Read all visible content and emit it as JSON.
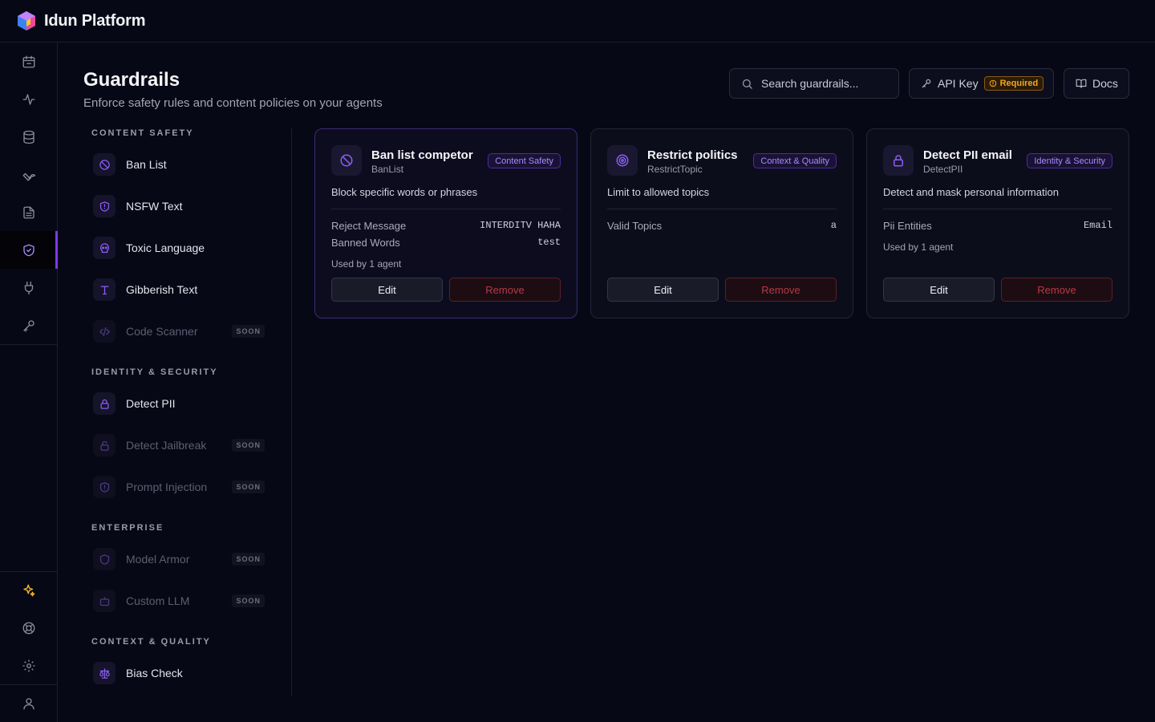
{
  "app": {
    "title": "Idun Platform"
  },
  "rail": {
    "items": [
      {
        "icon": "calendar-box-icon"
      },
      {
        "icon": "activity-icon"
      },
      {
        "icon": "database-icon"
      },
      {
        "icon": "wrench-icon"
      },
      {
        "icon": "document-icon"
      },
      {
        "icon": "shield-icon",
        "active": true
      },
      {
        "icon": "plug-icon"
      },
      {
        "icon": "key-icon"
      },
      {
        "icon": "sparkles-icon"
      },
      {
        "icon": "help-lifebuoy-icon"
      },
      {
        "icon": "settings-gear-icon"
      },
      {
        "icon": "user-icon"
      }
    ]
  },
  "header": {
    "title": "Guardrails",
    "subtitle": "Enforce safety rules and content policies on your agents",
    "search_placeholder": "Search guardrails...",
    "api_key_label": "API Key",
    "api_key_badge": "Required",
    "docs_label": "Docs"
  },
  "catalog": {
    "sections": [
      {
        "heading": "CONTENT SAFETY",
        "items": [
          {
            "label": "Ban List",
            "icon": "ban-icon",
            "soon": false
          },
          {
            "label": "NSFW Text",
            "icon": "shield-alert-icon",
            "soon": false
          },
          {
            "label": "Toxic Language",
            "icon": "skull-icon",
            "soon": false
          },
          {
            "label": "Gibberish Text",
            "icon": "type-icon",
            "soon": false
          },
          {
            "label": "Code Scanner",
            "icon": "code-icon",
            "soon": true,
            "soon_label": "SOON"
          }
        ]
      },
      {
        "heading": "IDENTITY & SECURITY",
        "items": [
          {
            "label": "Detect PII",
            "icon": "lock-icon",
            "soon": false
          },
          {
            "label": "Detect Jailbreak",
            "icon": "lock-open-icon",
            "soon": true,
            "soon_label": "SOON"
          },
          {
            "label": "Prompt Injection",
            "icon": "shield-alert-icon",
            "soon": true,
            "soon_label": "SOON"
          }
        ]
      },
      {
        "heading": "ENTERPRISE",
        "items": [
          {
            "label": "Model Armor",
            "icon": "shield-icon",
            "soon": true,
            "soon_label": "SOON"
          },
          {
            "label": "Custom LLM",
            "icon": "bot-icon",
            "soon": true,
            "soon_label": "SOON"
          }
        ]
      },
      {
        "heading": "CONTEXT & QUALITY",
        "items": [
          {
            "label": "Bias Check",
            "icon": "scale-icon",
            "soon": false
          }
        ]
      }
    ]
  },
  "cards": [
    {
      "title": "Ban list competor",
      "type": "BanList",
      "tag": "Content Safety",
      "description": "Block specific words or phrases",
      "params": [
        {
          "key": "Reject Message",
          "value": "INTERDITV HAHA"
        },
        {
          "key": "Banned Words",
          "value": "test"
        }
      ],
      "used_by": "Used by 1 agent",
      "edit_label": "Edit",
      "remove_label": "Remove",
      "icon": "ban-icon"
    },
    {
      "title": "Restrict politics",
      "type": "RestrictTopic",
      "tag": "Context & Quality",
      "description": "Limit to allowed topics",
      "params": [
        {
          "key": "Valid Topics",
          "value": "a"
        }
      ],
      "used_by": "",
      "edit_label": "Edit",
      "remove_label": "Remove",
      "icon": "target-icon"
    },
    {
      "title": "Detect PII email",
      "type": "DetectPII",
      "tag": "Identity & Security",
      "description": "Detect and mask personal information",
      "params": [
        {
          "key": "Pii Entities",
          "value": "Email"
        }
      ],
      "used_by": "Used by 1 agent",
      "edit_label": "Edit",
      "remove_label": "Remove",
      "icon": "lock-icon"
    }
  ],
  "colors": {
    "background": "#070816",
    "accent": "#7c3aed",
    "warning": "#f5a524",
    "danger": "#b43a46"
  }
}
